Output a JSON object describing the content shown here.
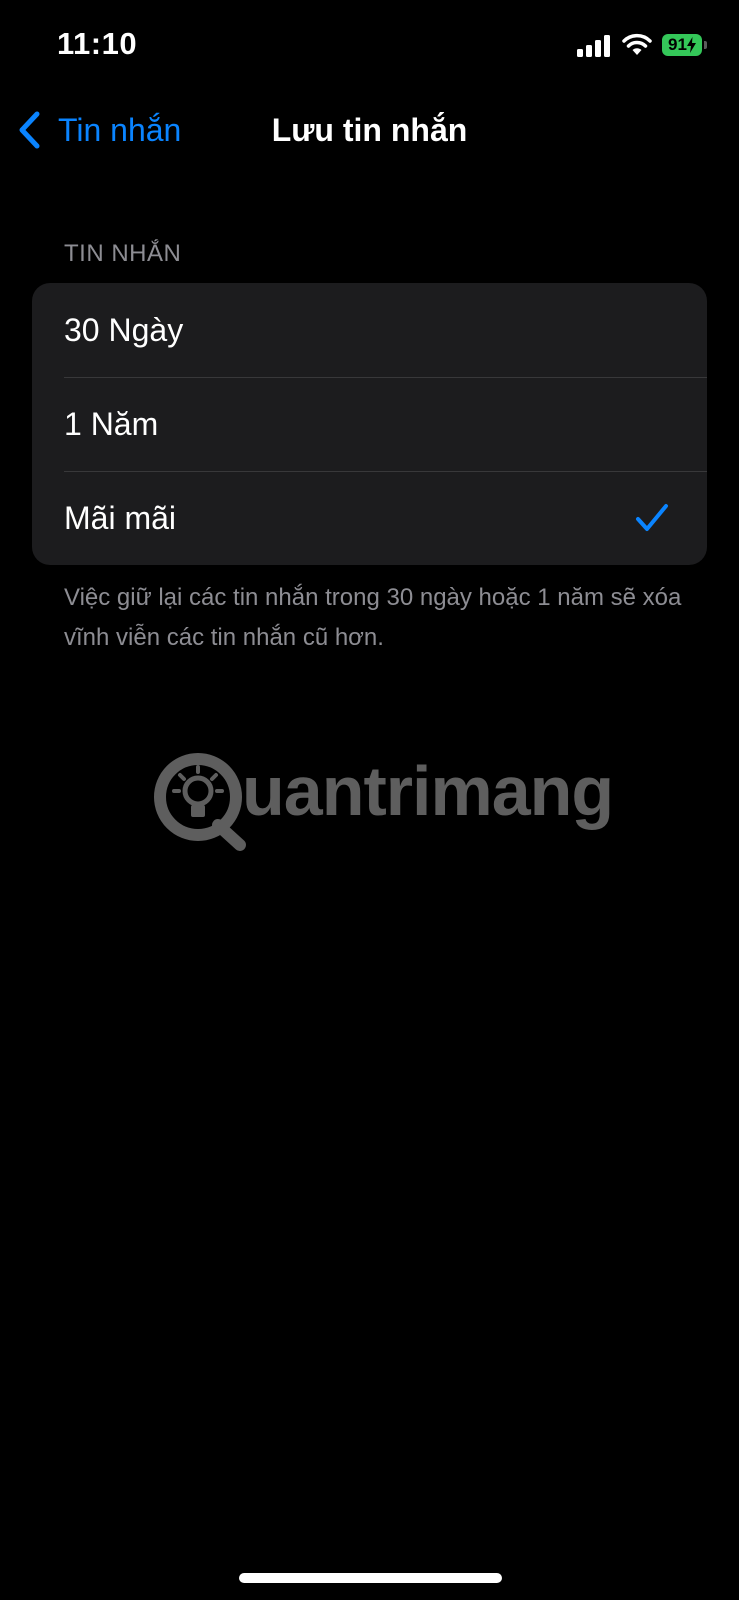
{
  "status_bar": {
    "time": "11:10",
    "battery_percent": "91",
    "battery_color": "#34c759",
    "icons": [
      "cellular-signal-icon",
      "wifi-icon",
      "battery-charging-icon"
    ]
  },
  "nav": {
    "back_label": "Tin nhắn",
    "title": "Lưu tin nhắn",
    "accent_color": "#0a84ff"
  },
  "section": {
    "header": "TIN NHẮN",
    "options": [
      {
        "label": "30 Ngày",
        "selected": false
      },
      {
        "label": "1 Năm",
        "selected": false
      },
      {
        "label": "Mãi mãi",
        "selected": true
      }
    ],
    "footer": "Việc giữ lại các tin nhắn trong 30 ngày hoặc 1 năm sẽ xóa vĩnh viễn các tin nhắn cũ hơn."
  },
  "watermark": {
    "text": "uantrimang"
  }
}
